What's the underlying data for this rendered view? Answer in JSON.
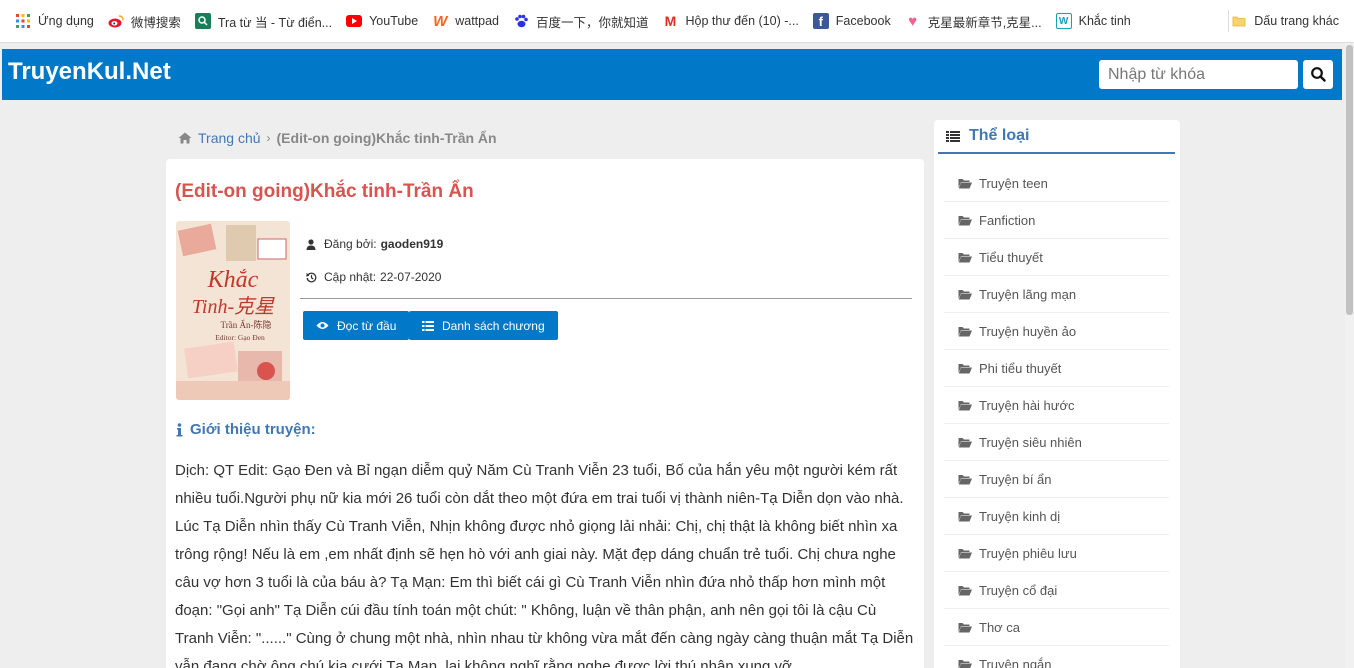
{
  "bookmarks": {
    "items": [
      {
        "label": "Ứng dụng",
        "icon": "apps-grid-icon"
      },
      {
        "label": "微博搜索",
        "icon": "weibo-icon"
      },
      {
        "label": "Tra từ 当 - Từ điển...",
        "icon": "dictionary-icon"
      },
      {
        "label": "YouTube",
        "icon": "youtube-icon"
      },
      {
        "label": "wattpad",
        "icon": "wattpad-icon"
      },
      {
        "label": "百度一下，你就知道",
        "icon": "baidu-icon"
      },
      {
        "label": "Hộp thư đến (10) -...",
        "icon": "gmail-icon"
      },
      {
        "label": "Facebook",
        "icon": "facebook-icon"
      },
      {
        "label": "克星最新章节,克星...",
        "icon": "heart-icon"
      },
      {
        "label": "Khắc tinh",
        "icon": "wattpad-w-icon"
      }
    ],
    "other": "Dấu trang khác"
  },
  "header": {
    "logo": "TruyenKul.Net",
    "search_placeholder": "Nhập từ khóa"
  },
  "breadcrumb": {
    "home": "Trang chủ",
    "current": "(Edit-on going)Khắc tinh-Trần Ẩn"
  },
  "story": {
    "title": "(Edit-on going)Khắc tinh-Trần Ẩn",
    "cover": {
      "line1": "Khắc",
      "line2": "Tinh-克星",
      "author": "Trần Ẩn-陈隐",
      "editor": "Editor: Gạo Đen"
    },
    "posted_by_label": "Đăng bởi:",
    "posted_by": "gaoden919",
    "updated_label": "Cập nhật:",
    "updated": "22-07-2020",
    "read_button": "Đọc từ đầu",
    "chapters_button": "Danh sách chương",
    "intro_heading": "Giới thiệu truyện:",
    "intro_text": "Dịch: QT Edit: Gạo Đen và Bỉ ngạn diễm quỷ Năm Cù Tranh Viễn 23 tuổi, Bố của hắn yêu một người kém rất nhiều tuổi.Người phụ nữ kia mới 26 tuổi còn dắt theo một đứa em trai tuổi vị thành niên-Tạ Diễn dọn vào nhà. Lúc Tạ Diễn nhìn thấy Cù Tranh Viễn, Nhịn không được nhỏ giọng lải nhải: Chị, chị thật là không biết nhìn xa trông rộng! Nếu là em ,em nhất định sẽ hẹn hò với anh giai này. Mặt đẹp dáng chuẩn trẻ tuổi. Chị chưa nghe câu vợ hơn 3 tuổi là của báu à? Tạ Mạn: Em thì biết cái gì Cù Tranh Viễn nhìn đứa nhỏ thấp hơn mình một đoạn: \"Gọi anh\" Tạ Diễn cúi đầu tính toán một chút: \" Không, luận về thân phận, anh nên gọi tôi là cậu Cù Tranh Viễn: \"......\" Cùng ở chung một nhà, nhìn nhau từ không vừa mắt đến càng ngày càng thuận mắt Tạ Diễn vẫn đang chờ ông chú kia cưới Tạ Mạn, lại không nghĩ rằng nghe được lời thú nhận xung vỡ"
  },
  "sidebar": {
    "heading": "Thể loại",
    "items": [
      "Truyện teen",
      "Fanfiction",
      "Tiểu thuyết",
      "Truyện lãng mạn",
      "Truyện huyền ảo",
      "Phi tiểu thuyết",
      "Truyện hài hước",
      "Truyện siêu nhiên",
      "Truyện bí ẩn",
      "Truyện kinh dị",
      "Truyện phiêu lưu",
      "Truyện cổ đại",
      "Thơ ca",
      "Truyện ngắn"
    ]
  },
  "colors": {
    "header_blue": "#0278c8",
    "title_red": "#d9534f",
    "accent_blue": "#4277b5"
  }
}
